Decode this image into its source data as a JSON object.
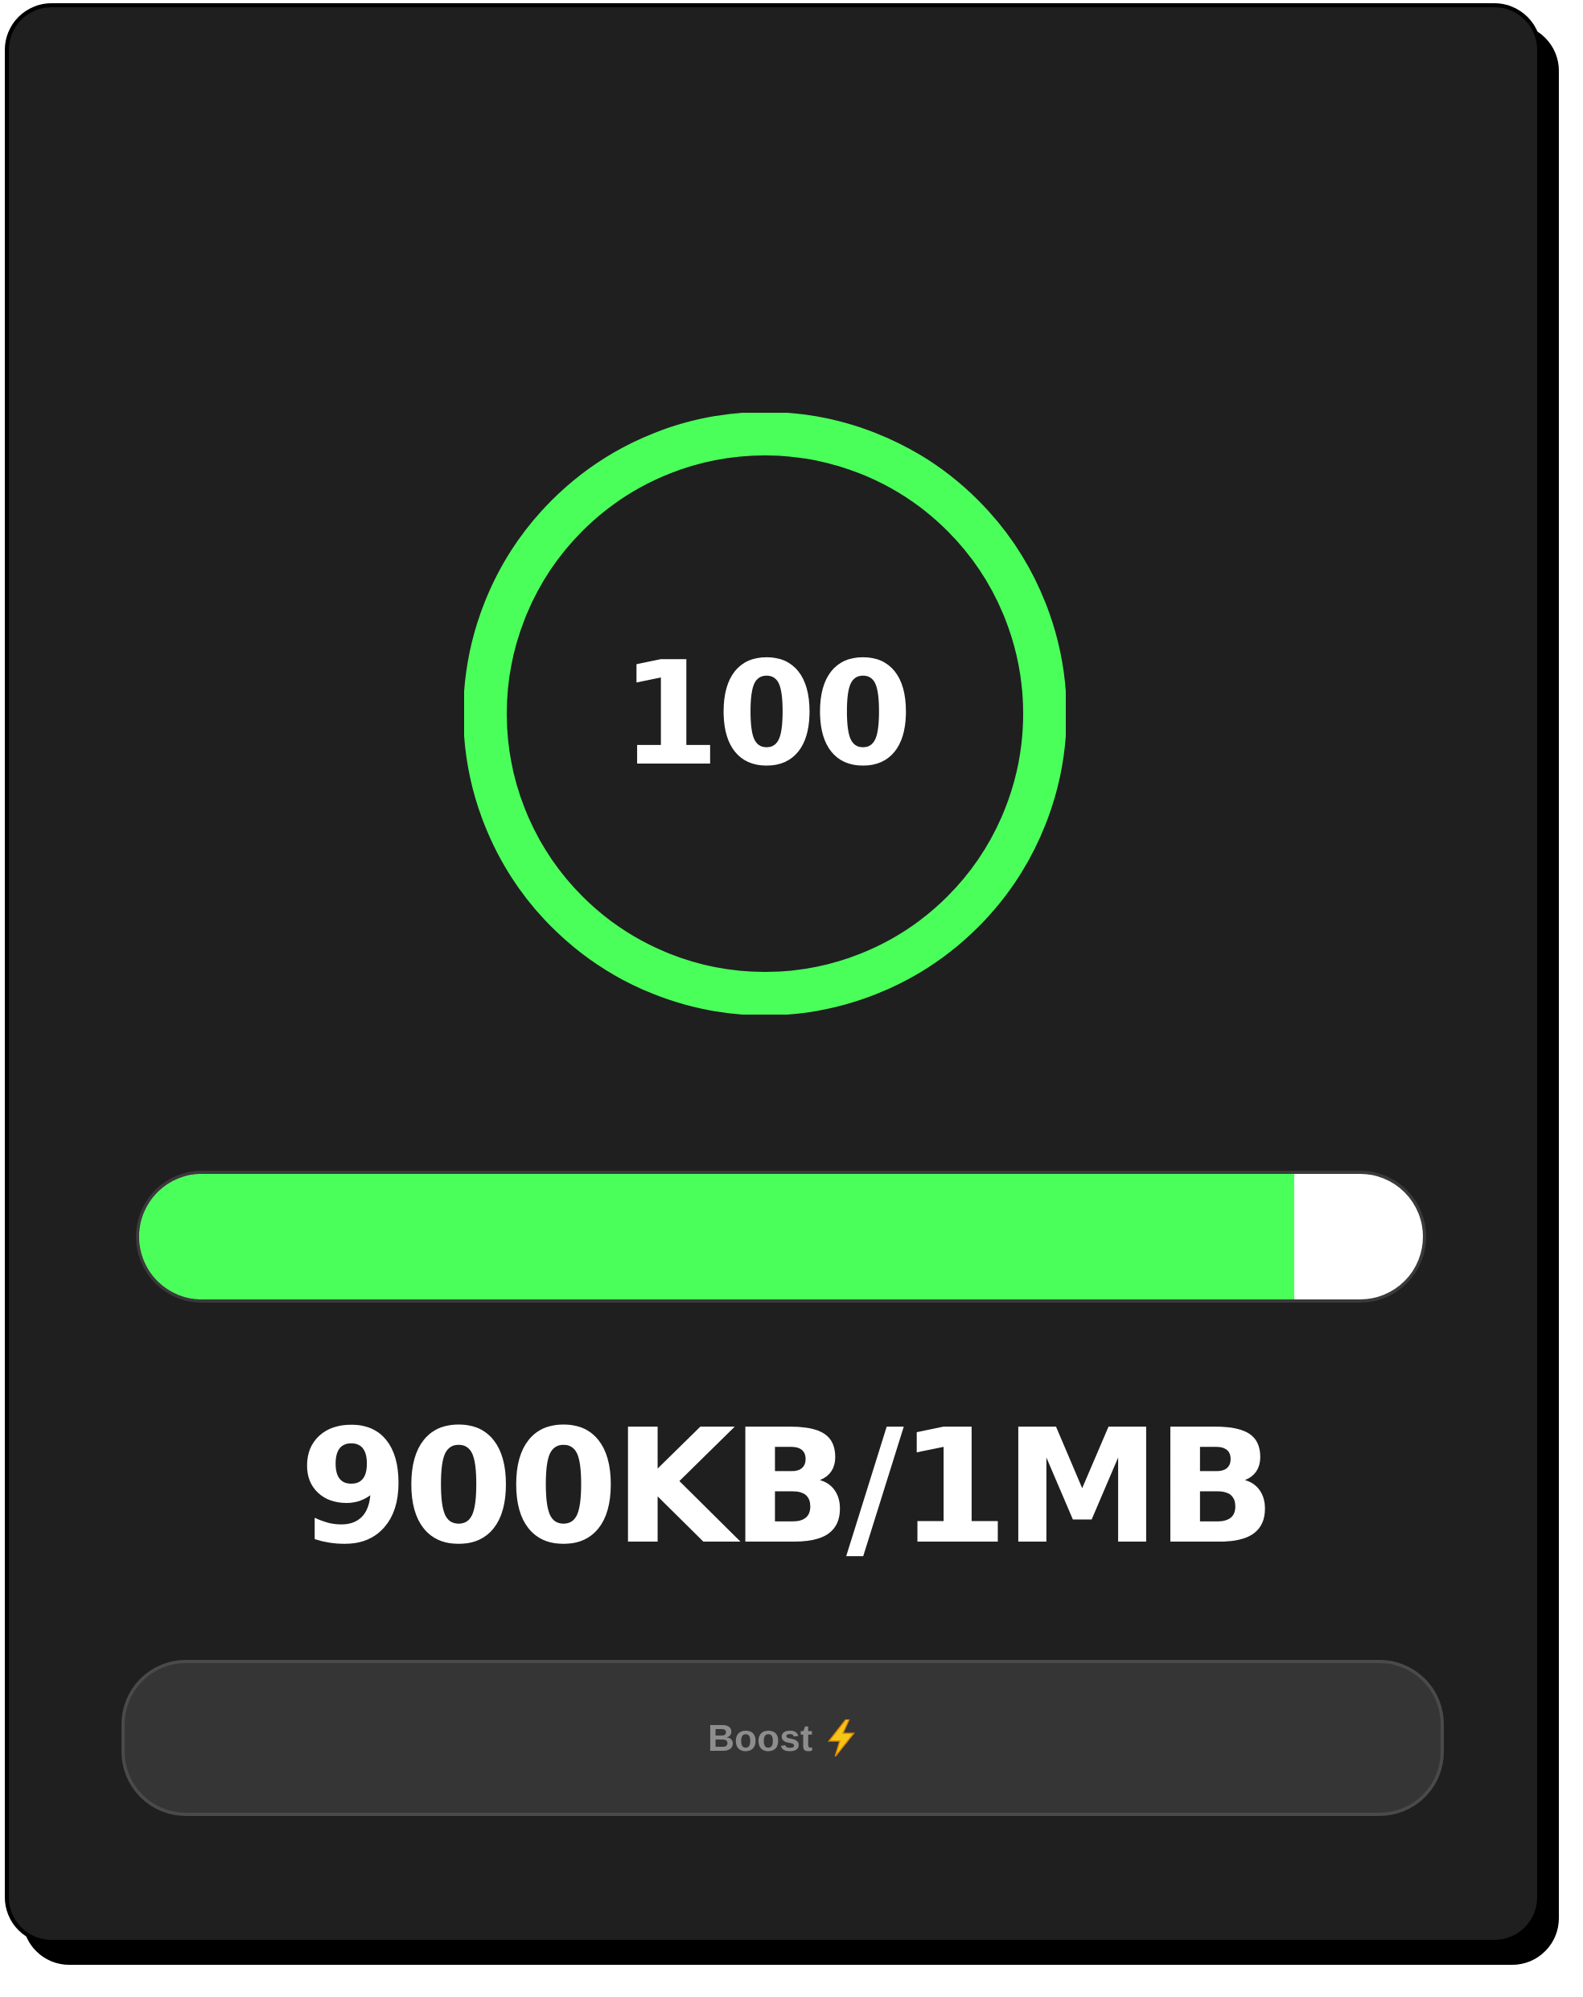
{
  "meter": {
    "value": "100",
    "progress_percent": 100,
    "ring_color": "#4bff5b"
  },
  "usage": {
    "label": "900KB/1MB",
    "fill_fraction": 0.9,
    "fill_color": "#4bff5b",
    "track_color": "#ffffff"
  },
  "boost_button": {
    "label": "Boost",
    "icon": "lightning-bolt-icon"
  }
}
